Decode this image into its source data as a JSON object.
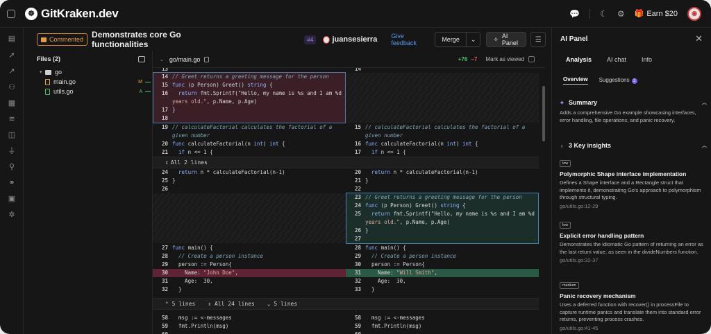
{
  "app": {
    "logo_text": "GitKraken.dev"
  },
  "topbar": {
    "earn_label": "Earn $20"
  },
  "pr": {
    "status_badge": "Commented",
    "title": "Demonstrates core Go functionalities",
    "number": "#4",
    "author": "juansesierra",
    "give_feedback": "Give feedback",
    "merge_label": "Merge",
    "ai_panel_label": "AI Panel"
  },
  "files": {
    "header": "Files (2)",
    "folder": "go",
    "items": [
      {
        "name": "main.go",
        "status": "M",
        "color": "#e6a93a"
      },
      {
        "name": "utils.go",
        "status": "A",
        "color": "#4cc26a"
      }
    ]
  },
  "diff": {
    "filename": "go/main.go",
    "additions": "+76",
    "deletions": "−7",
    "mark_viewed": "Mark as viewed",
    "fold1": "All 2 lines",
    "fold2_a": "5 lines",
    "fold2_b": "All 24 lines",
    "fold2_c": "5 lines",
    "left": [
      {
        "n": "13",
        "t": ""
      },
      {
        "n": "14",
        "t": "// Greet returns a greeting message for the person"
      },
      {
        "n": "15",
        "t": "func (p Person) Greet() string {"
      },
      {
        "n": "16",
        "t": "  return fmt.Sprintf(\"Hello, my name is %s and I am %d"
      },
      {
        "n": "",
        "t": "years old.\", p.Name, p.Age)"
      },
      {
        "n": "17",
        "t": "}"
      },
      {
        "n": "18",
        "t": ""
      },
      {
        "n": "19",
        "t": "// calculateFactorial calculates the factorial of a"
      },
      {
        "n": "",
        "t": "given number"
      },
      {
        "n": "20",
        "t": "func calculateFactorial(n int) int {"
      },
      {
        "n": "21",
        "t": "  if n <= 1 {"
      },
      {
        "n": "24",
        "t": "  return n * calculateFactorial(n-1)"
      },
      {
        "n": "25",
        "t": "}"
      },
      {
        "n": "26",
        "t": ""
      },
      {
        "n": "27",
        "t": "func main() {"
      },
      {
        "n": "28",
        "t": "  // Create a person instance"
      },
      {
        "n": "29",
        "t": "  person := Person{"
      },
      {
        "n": "30",
        "t": "    Name: \"John Doe\","
      },
      {
        "n": "31",
        "t": "    Age:  30,"
      },
      {
        "n": "32",
        "t": "  }"
      },
      {
        "n": "58",
        "t": "  msg := <-messages"
      },
      {
        "n": "59",
        "t": "  fmt.Println(msg)"
      },
      {
        "n": "60",
        "t": ""
      }
    ],
    "right": [
      {
        "n": "14",
        "t": ""
      },
      {
        "n": "15",
        "t": "// calculateFactorial calculates the factorial of a"
      },
      {
        "n": "",
        "t": "given number"
      },
      {
        "n": "16",
        "t": "func calculateFactorial(n int) int {"
      },
      {
        "n": "17",
        "t": "  if n <= 1 {"
      },
      {
        "n": "20",
        "t": "  return n * calculateFactorial(n-1)"
      },
      {
        "n": "21",
        "t": "}"
      },
      {
        "n": "22",
        "t": ""
      },
      {
        "n": "23",
        "t": "// Greet returns a greeting message for the person"
      },
      {
        "n": "24",
        "t": "func (p Person) Greet() string {"
      },
      {
        "n": "25",
        "t": "  return fmt.Sprintf(\"Hello, my name is %s and I am %d"
      },
      {
        "n": "",
        "t": "years old.\", p.Name, p.Age)"
      },
      {
        "n": "26",
        "t": "}"
      },
      {
        "n": "27",
        "t": ""
      },
      {
        "n": "28",
        "t": "func main() {"
      },
      {
        "n": "29",
        "t": "  // Create a person instance"
      },
      {
        "n": "30",
        "t": "  person := Person{"
      },
      {
        "n": "31",
        "t": "    Name: \"Will Smith\","
      },
      {
        "n": "32",
        "t": "    Age:  30,"
      },
      {
        "n": "33",
        "t": "  }"
      },
      {
        "n": "58",
        "t": "  msg := <-messages"
      },
      {
        "n": "59",
        "t": "  fmt.Println(msg)"
      },
      {
        "n": "60",
        "t": ""
      }
    ]
  },
  "ai": {
    "title": "AI Panel",
    "tabs": [
      "Analysis",
      "AI chat",
      "Info"
    ],
    "subtabs": [
      "Overview",
      "Suggestions"
    ],
    "suggestions_count": "3",
    "summary_title": "Summary",
    "summary_text": "Adds a comprehensive Go example showcasing interfaces, error handling, file operations, and panic recovery.",
    "insights_title": "3 Key insights",
    "insights": [
      {
        "tag": "low",
        "title": "Polymorphic Shape interface implementation",
        "text": "Defines a Shape interface and a Rectangle struct that implements it, demonstrating Go's approach to polymorphism through structural typing.",
        "link": "go/utils.go:12-29"
      },
      {
        "tag": "low",
        "title": "Explicit error handling pattern",
        "text": "Demonstrates the idiomatic Go pattern of returning an error as the last return value, as seen in the divideNumbers function.",
        "link": "go/utils.go:32-37"
      },
      {
        "tag": "medium",
        "title": "Panic recovery mechanism",
        "text": "Uses a deferred function with recover() in processFile to capture runtime panics and translate them into standard error returns, preventing process crashes.",
        "link": "go/utils.go:41-45"
      }
    ]
  }
}
